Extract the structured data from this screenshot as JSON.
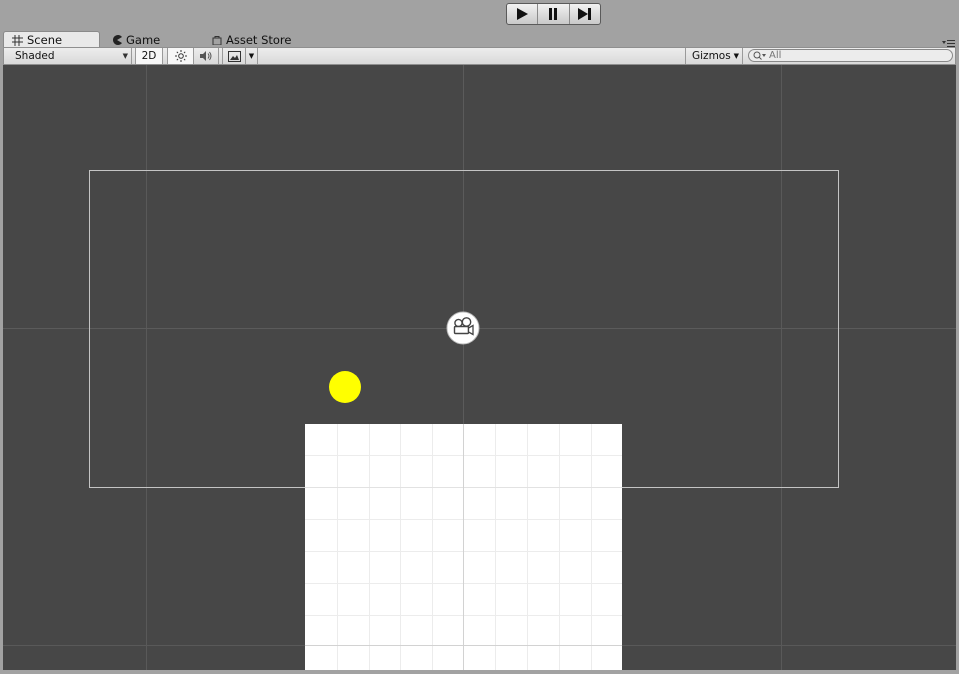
{
  "toolbar_controls": {
    "play": "play-icon",
    "pause": "pause-icon",
    "step": "step-icon"
  },
  "tabs": [
    {
      "label": "Scene",
      "icon": "grid-icon",
      "active": true
    },
    {
      "label": "Game",
      "icon": "pacman-icon",
      "active": false
    },
    {
      "label": "Asset Store",
      "icon": "shopping-bag-icon",
      "active": false
    }
  ],
  "scene_toolbar": {
    "shading_mode": "Shaded",
    "mode_2d_label": "2D",
    "lighting_icon": "sun-icon",
    "audio_icon": "speaker-icon",
    "effects_icon": "image-icon",
    "gizmos_label": "Gizmos",
    "search_placeholder": "All"
  },
  "colors": {
    "scene_background": "#474747",
    "grid_line": "#5a5a5a",
    "camera_bounds": "#bdbdbd",
    "ball": "#ffff00",
    "platform": "#ffffff"
  },
  "scene_objects": [
    "camera-icon",
    "yellow-ball",
    "white-platform",
    "camera-bounds"
  ]
}
